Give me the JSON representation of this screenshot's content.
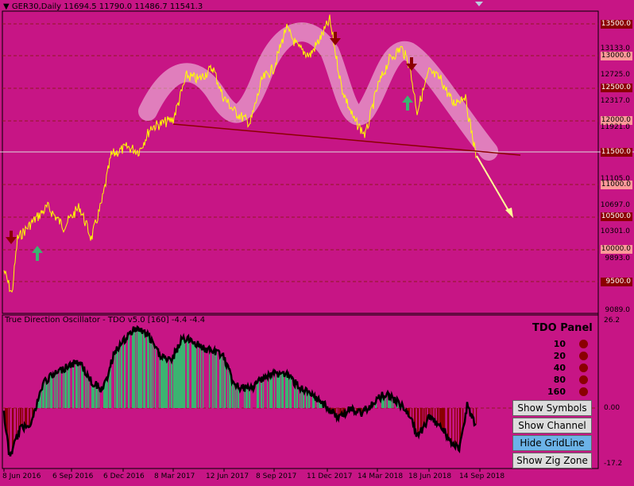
{
  "chart_header": {
    "symbol_line": "GER30,Daily  11694.5 11790.0 11486.7 11541.3"
  },
  "price_axis": {
    "labels": [
      "13500.0",
      "13133.0",
      "13000.0",
      "12725.0",
      "12500.0",
      "12317.0",
      "12000.0",
      "11921.0",
      "11500.0",
      "11105.0",
      "11000.0",
      "10697.0",
      "10500.0",
      "10301.0",
      "10000.0",
      "9893.0",
      "9500.0",
      "9089.0"
    ],
    "boxed": [
      "13500.0",
      "13000.0",
      "12500.0",
      "12000.0",
      "11500.0",
      "11000.0",
      "10500.0",
      "10000.0",
      "9500.0"
    ]
  },
  "oscillator": {
    "title": "True Direction Oscillator - TDO v5.0 [160] -4.4 -4.4",
    "axis_labels": [
      "26.2",
      "0.00",
      "-17.2"
    ]
  },
  "tdo_panel": {
    "title": "TDO Panel",
    "periods": [
      "10",
      "20",
      "40",
      "80",
      "160"
    ],
    "dot_color": "#8b0000"
  },
  "buttons": {
    "show_symbols": "Show Symbols",
    "show_channel": "Show Channel",
    "hide_gridline": "Hide GridLine",
    "show_zig_zone": "Show Zig Zone"
  },
  "date_axis": [
    "8 Jun 2016",
    "6 Sep 2016",
    "6 Dec 2016",
    "8 Mar 2017",
    "12 Jun 2017",
    "8 Sep 2017",
    "11 Dec 2017",
    "14 Mar 2018",
    "18 Jun 2018",
    "14 Sep 2018"
  ],
  "colors": {
    "background": "#c71585",
    "price_line": "#ffff00",
    "neckline": "#8b0000",
    "osc_up": "#3cb371",
    "osc_down": "#8b0000",
    "button_active": "#6cb3e8"
  }
}
